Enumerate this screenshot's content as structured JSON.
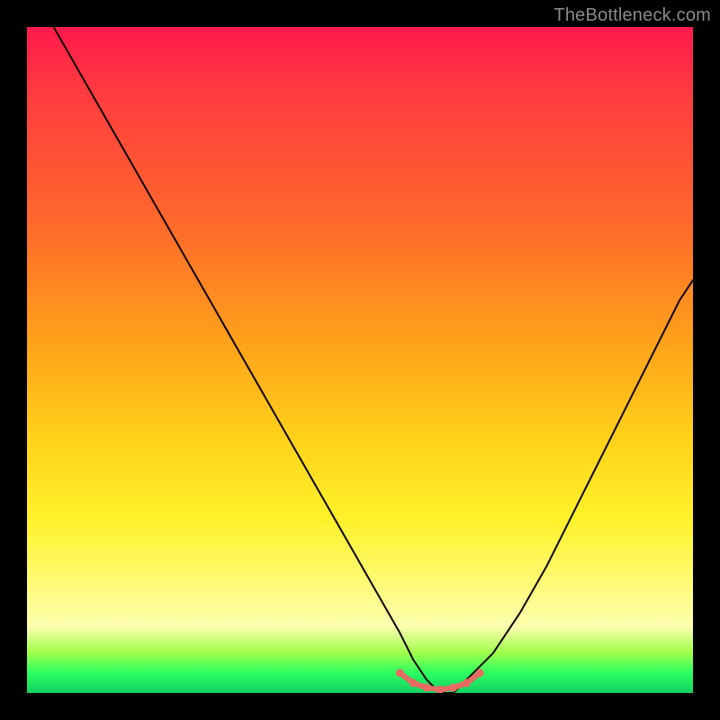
{
  "watermark": "TheBottleneck.com",
  "colors": {
    "background": "#000000",
    "curve_stroke": "#0d0400",
    "accent_stroke": "#e86a63",
    "accent_fill": "#e86a63",
    "gradient_stops": [
      "#ff1a4d",
      "#ff3b3f",
      "#ff6a2b",
      "#ffa41a",
      "#ffd21a",
      "#fff22a",
      "#fffb7a",
      "#fdffb0",
      "#9fff4a",
      "#2bff60",
      "#10d060"
    ]
  },
  "chart_data": {
    "type": "line",
    "title": "",
    "xlabel": "",
    "ylabel": "",
    "xlim": [
      0,
      100
    ],
    "ylim": [
      0,
      100
    ],
    "series": [
      {
        "name": "curve",
        "x": [
          4,
          8,
          12,
          16,
          20,
          24,
          28,
          32,
          36,
          40,
          44,
          48,
          52,
          56,
          58,
          60,
          62,
          64,
          66,
          70,
          74,
          78,
          82,
          86,
          90,
          94,
          98,
          100
        ],
        "y": [
          100,
          93,
          86,
          79,
          72,
          65,
          58,
          51,
          44,
          37,
          30,
          23,
          16,
          9,
          5,
          2,
          0,
          0,
          2,
          6,
          12,
          19,
          27,
          35,
          43,
          51,
          59,
          62
        ]
      }
    ],
    "accent_segment": {
      "comment": "short pink/red dotted segment along the flat bottom of the curve",
      "x": [
        56,
        58,
        60,
        62,
        64,
        66,
        68
      ],
      "y": [
        3,
        1.5,
        0.8,
        0.5,
        0.8,
        1.5,
        3
      ]
    }
  }
}
